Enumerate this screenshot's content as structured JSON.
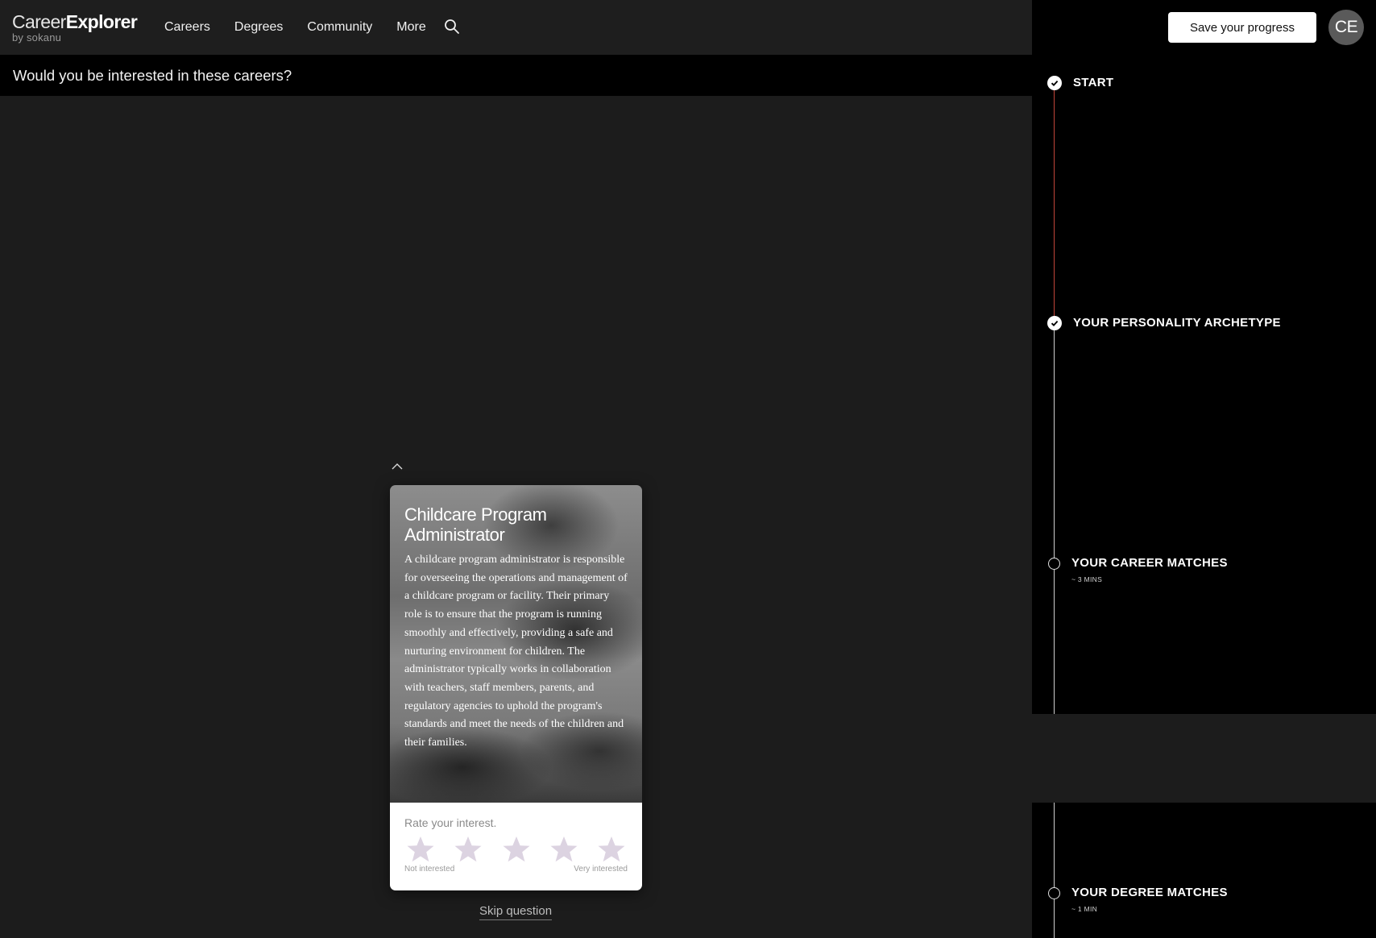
{
  "header": {
    "logo_light": "Career",
    "logo_bold": "Explorer",
    "logo_sub": "by sokanu",
    "nav": [
      "Careers",
      "Degrees",
      "Community",
      "More"
    ]
  },
  "question": "Would you be interested in these careers?",
  "card": {
    "title": "Childcare Program Administrator",
    "description": "A childcare program administrator is responsible for overseeing the operations and management of a childcare program or facility. Their primary role is to ensure that the program is running smoothly and effectively, providing a safe and nurturing environment for children. The administrator typically works in collaboration with teachers, staff members, parents, and regulatory agencies to uphold the program's standards and meet the needs of the children and their families.",
    "rate_label": "Rate your interest.",
    "scale_low": "Not interested",
    "scale_high": "Very interested",
    "star_count": 5,
    "star_color": "#dcd3e1"
  },
  "skip_label": "Skip question",
  "sidebar": {
    "save_label": "Save your progress",
    "avatar": "CE",
    "steps": [
      {
        "label": "START",
        "time": "",
        "status": "done"
      },
      {
        "label": "YOUR PERSONALITY ARCHETYPE",
        "time": "",
        "status": "done"
      },
      {
        "label": "YOUR CAREER MATCHES",
        "time": "~ 3 MINS",
        "status": "pending"
      },
      {
        "label": "YOUR DEGREE MATCHES",
        "time": "~ 1 MIN",
        "status": "pending"
      }
    ],
    "progress_color": "#c2453a"
  }
}
